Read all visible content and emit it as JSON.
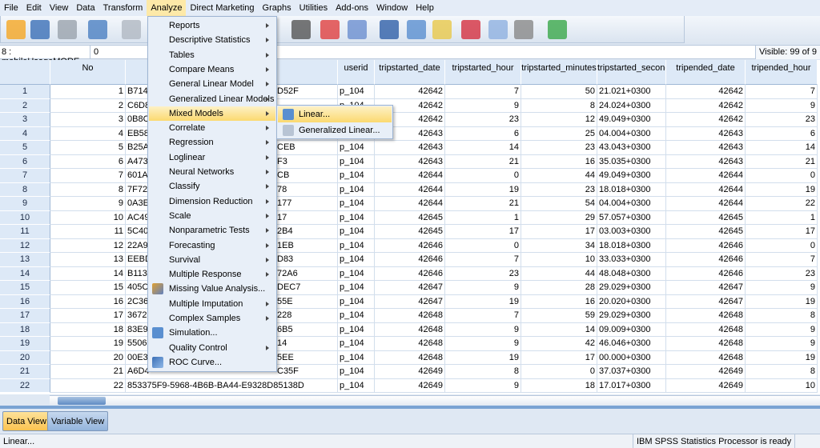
{
  "menubar": [
    "File",
    "Edit",
    "View",
    "Data",
    "Transform",
    "Analyze",
    "Direct Marketing",
    "Graphs",
    "Utilities",
    "Add-ons",
    "Window",
    "Help"
  ],
  "active_menu": "Analyze",
  "toolbar_icons": [
    "open-folder-icon",
    "save-icon",
    "print-icon",
    "dialog-recall-icon",
    "undo-icon",
    "find-binoculars-icon",
    "insert-cases-icon",
    "insert-variable-icon",
    "split-file-icon",
    "weight-cases-icon",
    "select-cases-icon",
    "value-labels-icon",
    "use-sets-icon",
    "show-all-variables-icon",
    "spell-check-icon"
  ],
  "cell_editor": {
    "ref": "8 : mobileUsageMORE...",
    "value": "0",
    "visible": "Visible: 99 of 9"
  },
  "columns": [
    "No",
    "",
    "userid",
    "tripstarted_date",
    "tripstarted_hour",
    "tripstarted_minutes",
    "tripstarted_seconds",
    "tripended_date",
    "tripended_hour"
  ],
  "rows": [
    [
      "1",
      "1",
      "B714",
      "D52F",
      "p_104",
      "42642",
      "7",
      "50",
      "21.021+0300",
      "42642",
      "7"
    ],
    [
      "2",
      "2",
      "C6D8",
      "",
      "p_104",
      "42642",
      "9",
      "8",
      "24.024+0300",
      "42642",
      "9"
    ],
    [
      "3",
      "3",
      "0B8C",
      "",
      "p_104",
      "42642",
      "23",
      "12",
      "49.049+0300",
      "42642",
      "23"
    ],
    [
      "4",
      "4",
      "EB58",
      "",
      "p_104",
      "42643",
      "6",
      "25",
      "04.004+0300",
      "42643",
      "6"
    ],
    [
      "5",
      "5",
      "B25A",
      "CEB",
      "p_104",
      "42643",
      "14",
      "23",
      "43.043+0300",
      "42643",
      "14"
    ],
    [
      "6",
      "6",
      "A473",
      "F3",
      "p_104",
      "42643",
      "21",
      "16",
      "35.035+0300",
      "42643",
      "21"
    ],
    [
      "7",
      "7",
      "601A",
      "CB",
      "p_104",
      "42644",
      "0",
      "44",
      "49.049+0300",
      "42644",
      "0"
    ],
    [
      "8",
      "8",
      "7F72",
      "78",
      "p_104",
      "42644",
      "19",
      "23",
      "18.018+0300",
      "42644",
      "19"
    ],
    [
      "9",
      "9",
      "0A3E",
      "177",
      "p_104",
      "42644",
      "21",
      "54",
      "04.004+0300",
      "42644",
      "22"
    ],
    [
      "10",
      "10",
      "AC49",
      "17",
      "p_104",
      "42645",
      "1",
      "29",
      "57.057+0300",
      "42645",
      "1"
    ],
    [
      "11",
      "11",
      "5C40",
      "2B4",
      "p_104",
      "42645",
      "17",
      "17",
      "03.003+0300",
      "42645",
      "17"
    ],
    [
      "12",
      "12",
      "22A9",
      "1EB",
      "p_104",
      "42646",
      "0",
      "34",
      "18.018+0300",
      "42646",
      "0"
    ],
    [
      "13",
      "13",
      "EEBD",
      "D83",
      "p_104",
      "42646",
      "7",
      "10",
      "33.033+0300",
      "42646",
      "7"
    ],
    [
      "14",
      "14",
      "B113",
      "72A6",
      "p_104",
      "42646",
      "23",
      "44",
      "48.048+0300",
      "42646",
      "23"
    ],
    [
      "15",
      "15",
      "405C",
      "DEC7",
      "p_104",
      "42647",
      "9",
      "28",
      "29.029+0300",
      "42647",
      "9"
    ],
    [
      "16",
      "16",
      "2C36",
      "55E",
      "p_104",
      "42647",
      "19",
      "16",
      "20.020+0300",
      "42647",
      "19"
    ],
    [
      "17",
      "17",
      "3672",
      "228",
      "p_104",
      "42648",
      "7",
      "59",
      "29.029+0300",
      "42648",
      "8"
    ],
    [
      "18",
      "18",
      "83E9",
      "6B5",
      "p_104",
      "42648",
      "9",
      "14",
      "09.009+0300",
      "42648",
      "9"
    ],
    [
      "19",
      "19",
      "5506",
      "14",
      "p_104",
      "42648",
      "9",
      "42",
      "46.046+0300",
      "42648",
      "9"
    ],
    [
      "20",
      "20",
      "00E3",
      "5EE",
      "p_104",
      "42648",
      "19",
      "17",
      "00.000+0300",
      "42648",
      "19"
    ],
    [
      "21",
      "21",
      "A6D4",
      "C35F",
      "p_104",
      "42649",
      "8",
      "0",
      "37.037+0300",
      "42649",
      "8"
    ],
    [
      "22",
      "22",
      "853375F9-5968-4B6B-BA44-E9328D85138D",
      "",
      "p_104",
      "42649",
      "9",
      "18",
      "17.017+0300",
      "42649",
      "10"
    ]
  ],
  "analyze_menu": [
    {
      "label": "Reports",
      "sub": true
    },
    {
      "label": "Descriptive Statistics",
      "sub": true
    },
    {
      "label": "Tables",
      "sub": true
    },
    {
      "label": "Compare Means",
      "sub": true
    },
    {
      "label": "General Linear Model",
      "sub": true
    },
    {
      "label": "Generalized Linear Models",
      "sub": true
    },
    {
      "label": "Mixed Models",
      "sub": true,
      "highlighted": true
    },
    {
      "label": "Correlate",
      "sub": true
    },
    {
      "label": "Regression",
      "sub": true
    },
    {
      "label": "Loglinear",
      "sub": true
    },
    {
      "label": "Neural Networks",
      "sub": true
    },
    {
      "label": "Classify",
      "sub": true
    },
    {
      "label": "Dimension Reduction",
      "sub": true
    },
    {
      "label": "Scale",
      "sub": true
    },
    {
      "label": "Nonparametric Tests",
      "sub": true
    },
    {
      "label": "Forecasting",
      "sub": true
    },
    {
      "label": "Survival",
      "sub": true
    },
    {
      "label": "Multiple Response",
      "sub": true
    },
    {
      "label": "Missing Value Analysis...",
      "icon": "missing-value-icon"
    },
    {
      "label": "Multiple Imputation",
      "sub": true
    },
    {
      "label": "Complex Samples",
      "sub": true
    },
    {
      "label": "Simulation...",
      "icon": "simulation-icon"
    },
    {
      "label": "Quality Control",
      "sub": true
    },
    {
      "label": "ROC Curve...",
      "icon": "roc-curve-icon"
    }
  ],
  "mixed_submenu": [
    {
      "label": "Linear...",
      "icon": "linear-mixed-icon",
      "highlighted": true
    },
    {
      "label": "Generalized Linear...",
      "icon": "generalized-linear-icon"
    }
  ],
  "tabs": {
    "data_view": "Data View",
    "variable_view": "Variable View",
    "active": "Data View"
  },
  "status": {
    "left": "Linear...",
    "processor": "IBM SPSS Statistics Processor is ready"
  },
  "colors": {
    "highlight": "#fbd970",
    "header": "#dde9f7",
    "active_tab": "#fcc95a"
  }
}
